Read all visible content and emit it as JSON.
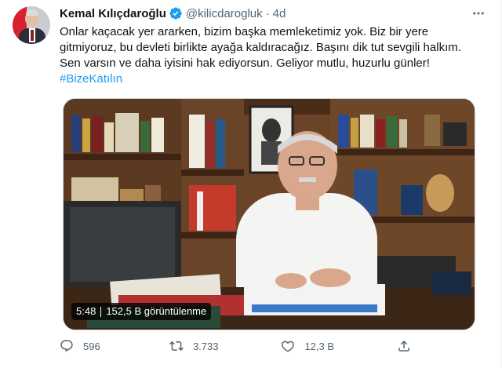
{
  "author": {
    "display_name": "Kemal Kılıçdaroğlu",
    "handle": "@kilicdarogluk",
    "separator": "·",
    "time": "4d"
  },
  "tweet": {
    "text": "Onlar kaçacak yer ararken, bizim başka memleketimiz yok. Biz bir yere gitmiyoruz, bu devleti birlikte ayağa kaldıracağız. Başını dik tut sevgili halkım. Sen varsın ve daha iyisini hak ediyorsun. Geliyor mutlu, huzurlu günler!",
    "hashtag": "#BizeKatılın"
  },
  "video": {
    "duration": "5:48",
    "views": "152,5 B görüntülenme"
  },
  "actions": {
    "replies": "596",
    "retweets": "3.733",
    "likes": "12,3 B"
  },
  "icons": {
    "verified": "verified-badge-icon",
    "more": "more-icon",
    "reply": "reply-icon",
    "retweet": "retweet-icon",
    "like": "like-icon",
    "share": "share-icon"
  },
  "colors": {
    "accent": "#1d9bf0",
    "text": "#0f1419",
    "secondary": "#536471"
  }
}
